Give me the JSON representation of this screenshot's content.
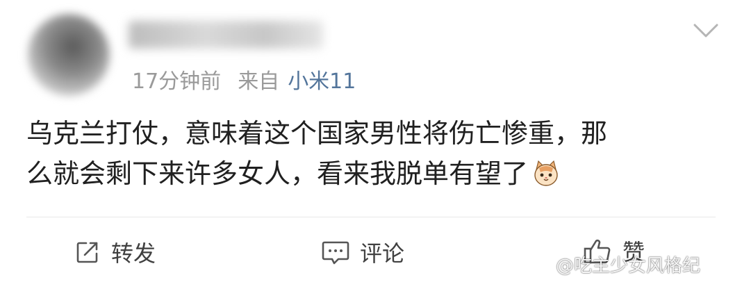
{
  "post": {
    "time": "17分钟前",
    "source_prefix": "来自",
    "device": "小米11",
    "text_lines": [
      "乌克兰打仗，意味着这个国家男性将伤亡惨重，那",
      "么就会剩下来许多女人，看来我脱单有望了"
    ],
    "emoji": "cat-emoji"
  },
  "actions": {
    "repost_label": "转发",
    "comment_label": "评论",
    "like_label": "赞"
  },
  "watermark": "@吃主少女风格纪",
  "icons": {
    "expand": "chevron-down-icon",
    "repost": "repost-icon",
    "comment": "comment-icon",
    "like": "thumbs-up-icon",
    "weibo": "weibo-logo-icon"
  },
  "colors": {
    "text": "#202020",
    "meta": "#9a9a9a",
    "device": "#53759b",
    "action": "#404040"
  }
}
